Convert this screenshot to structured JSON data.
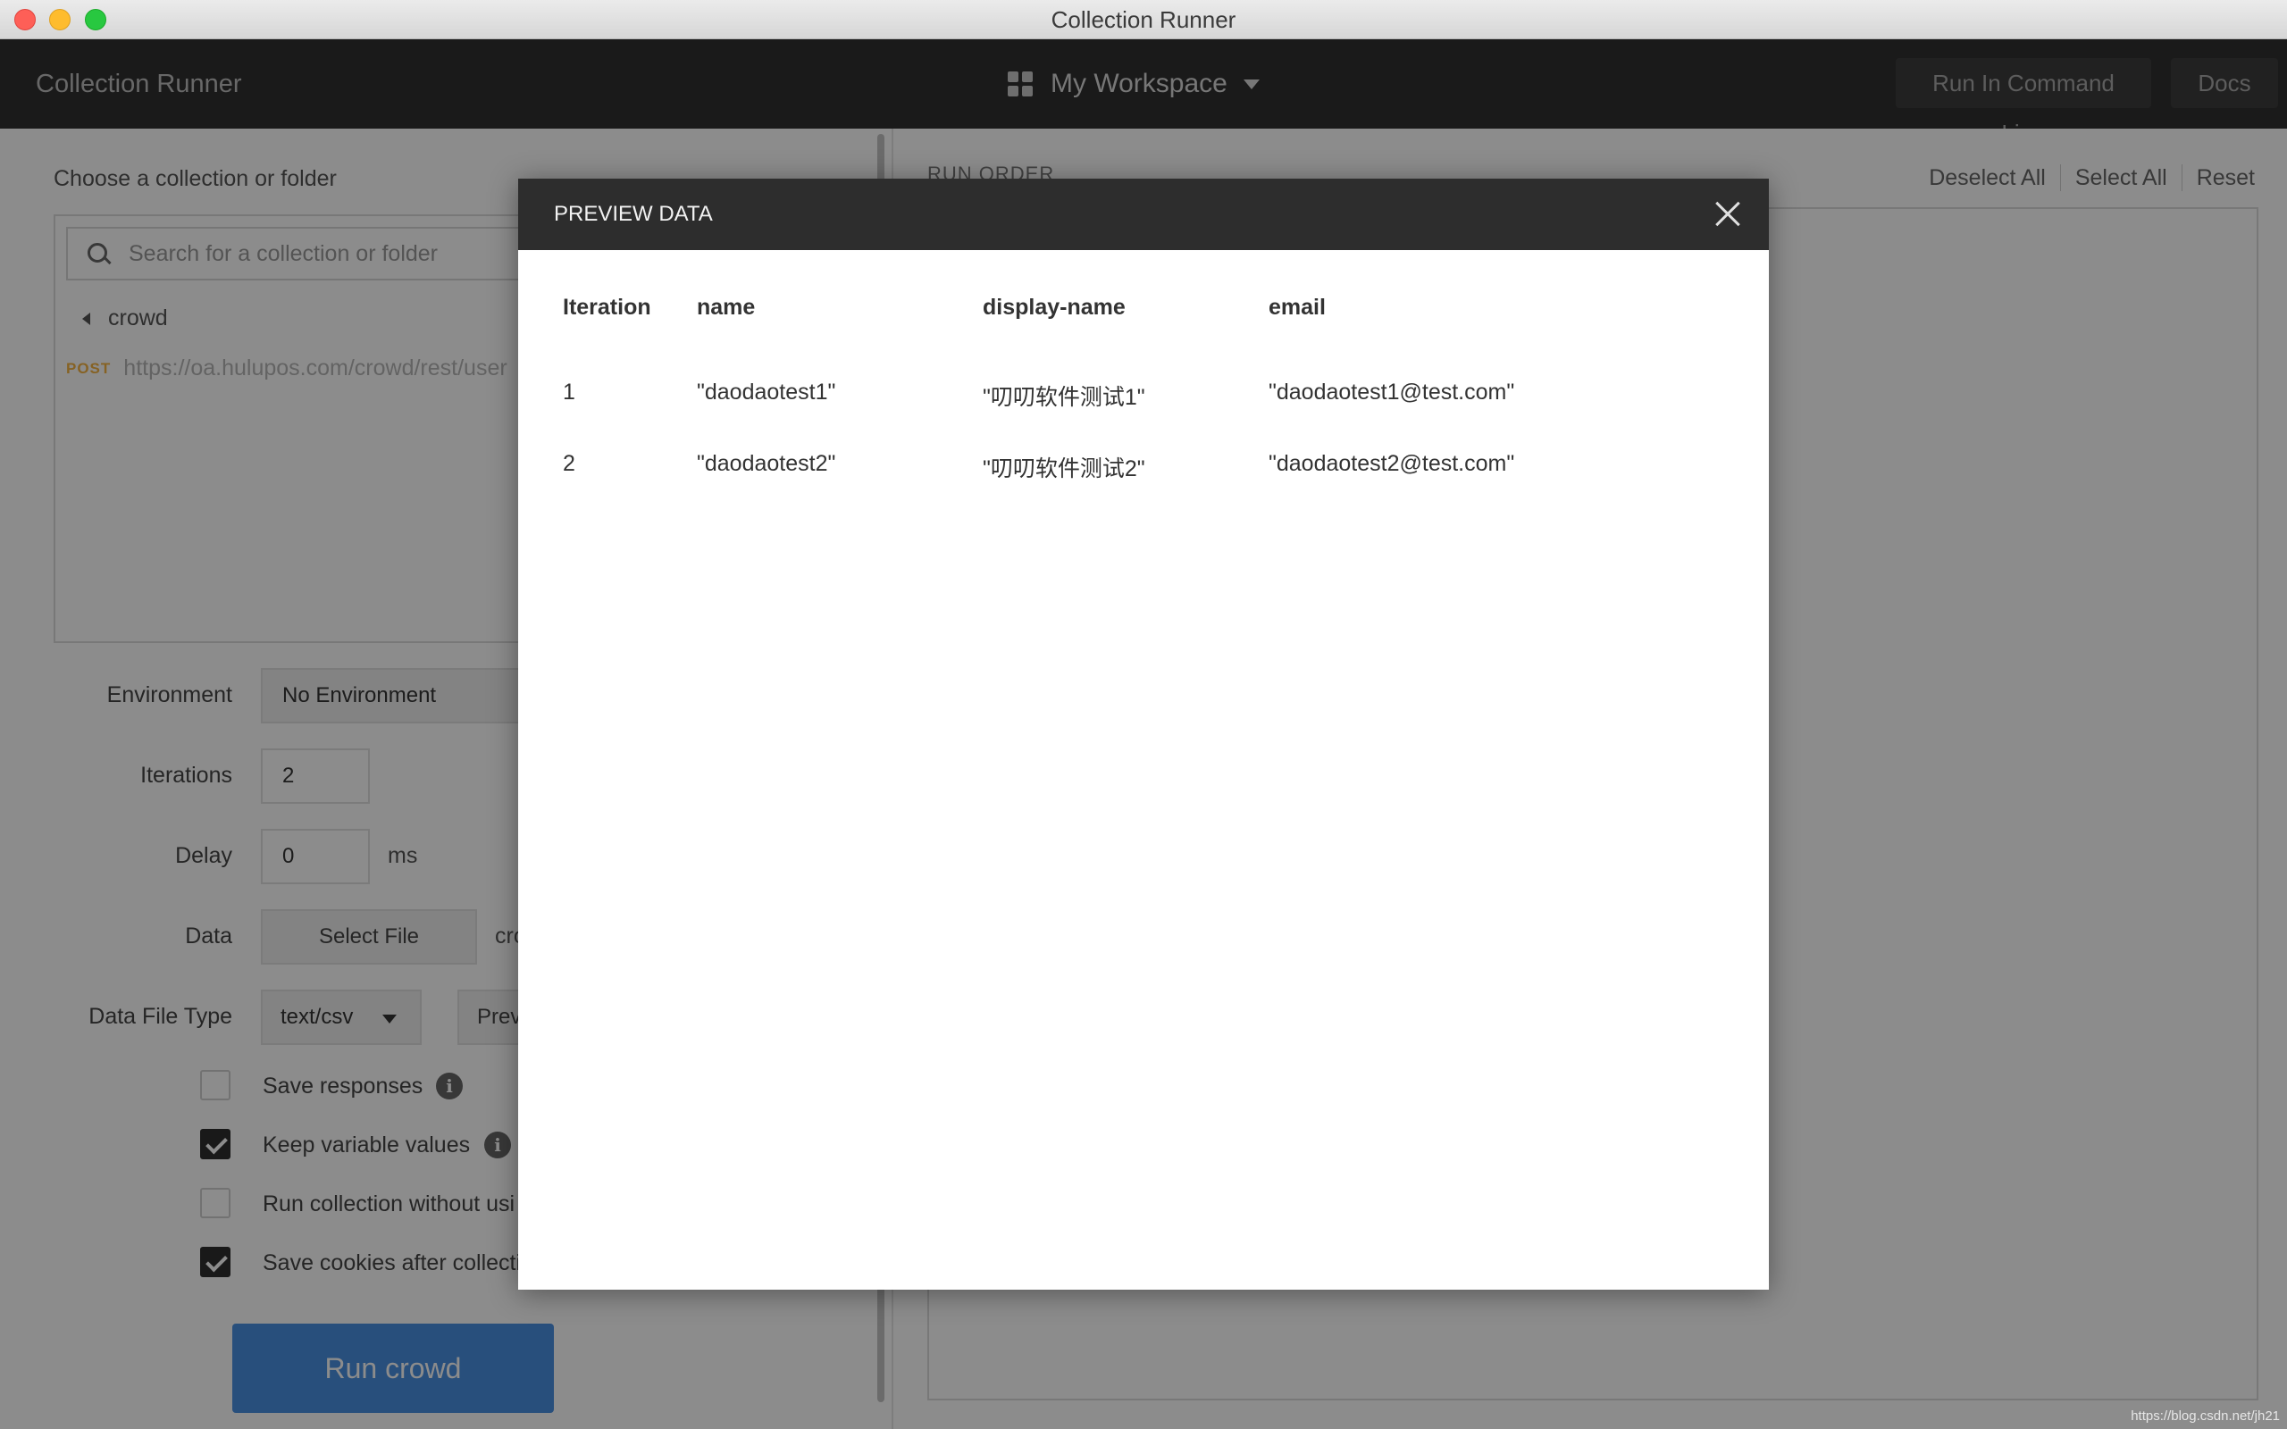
{
  "window": {
    "title": "Collection Runner"
  },
  "header": {
    "app_title": "Collection Runner",
    "workspace": "My Workspace",
    "run_cmd_label": "Run In Command Line",
    "docs_label": "Docs"
  },
  "left": {
    "choose_label": "Choose a collection or folder",
    "search_placeholder": "Search for a collection or folder",
    "collection_name": "crowd",
    "request": {
      "method": "POST",
      "url": "https://oa.hulupos.com/crowd/rest/user"
    },
    "environment_label": "Environment",
    "environment_value": "No Environment",
    "iterations_label": "Iterations",
    "iterations_value": "2",
    "delay_label": "Delay",
    "delay_value": "0",
    "delay_unit": "ms",
    "data_label": "Data",
    "select_file_label": "Select File",
    "file_name": "cro",
    "file_type_label": "Data File Type",
    "file_type_value": "text/csv",
    "preview_label": "Prev",
    "options": [
      {
        "label": "Save responses",
        "checked": false
      },
      {
        "label": "Keep variable values",
        "checked": true
      },
      {
        "label": "Run collection without usi",
        "checked": false
      },
      {
        "label": "Save cookies after collecti",
        "checked": true
      }
    ],
    "run_button": "Run crowd"
  },
  "right": {
    "run_order": "RUN ORDER",
    "deselect_all": "Deselect All",
    "select_all": "Select All",
    "reset": "Reset"
  },
  "modal": {
    "title": "PREVIEW DATA",
    "columns": [
      "Iteration",
      "name",
      "display-name",
      "email"
    ],
    "rows": [
      [
        "1",
        "\"daodaotest1\"",
        "\"叨叨软件测试1\"",
        "\"daodaotest1@test.com\""
      ],
      [
        "2",
        "\"daodaotest2\"",
        "\"叨叨软件测试2\"",
        "\"daodaotest2@test.com\""
      ]
    ]
  },
  "watermark": "https://blog.csdn.net/jh21",
  "colors": {
    "accent": "#4a90e2",
    "header_bg": "#303030",
    "modal_header_bg": "#2d2d2d"
  }
}
